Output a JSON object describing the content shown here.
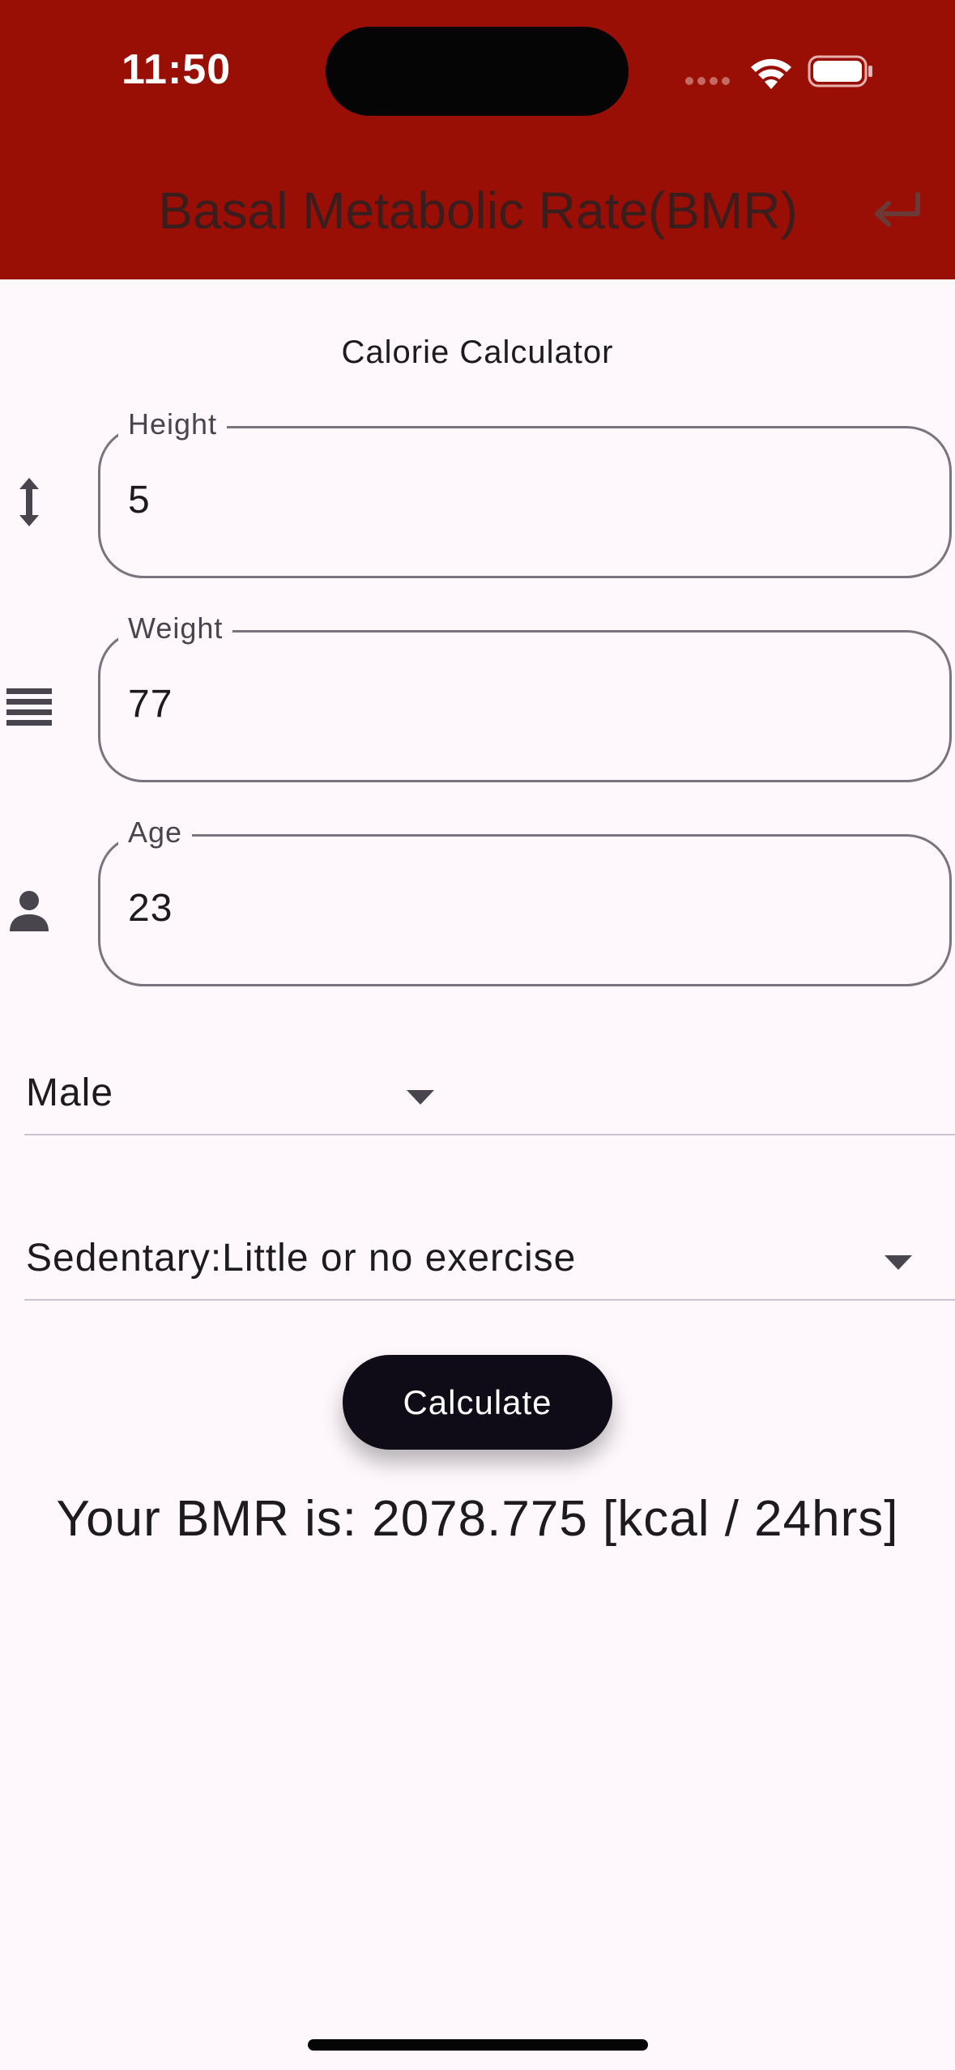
{
  "status_bar": {
    "time": "11:50"
  },
  "app_bar": {
    "title": "Basal Metabolic Rate(BMR)",
    "background_color": "#990f05",
    "action_icon": "return-arrow-icon"
  },
  "form": {
    "subtitle": "Calorie Calculator",
    "fields": [
      {
        "label": "Height",
        "value": "5",
        "icon": "vertical-arrows-icon"
      },
      {
        "label": "Weight",
        "value": "77",
        "icon": "lines-icon"
      },
      {
        "label": "Age",
        "value": "23",
        "icon": "person-icon"
      }
    ],
    "gender_select": {
      "selected": "Male"
    },
    "activity_select": {
      "selected": "Sedentary:Little or no exercise"
    },
    "calculate_label": "Calculate"
  },
  "result": {
    "text": "Your BMR is: 2078.775 [kcal / 24hrs]"
  },
  "colors": {
    "accent": "#990f05",
    "button": "#0f0c17",
    "background": "#fef8fc"
  }
}
